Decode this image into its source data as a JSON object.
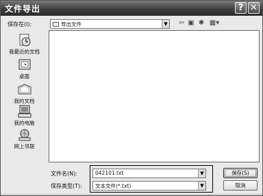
{
  "window": {
    "title": "文件导出",
    "help_label": "?",
    "close_label": "✕"
  },
  "location": {
    "label": "保存在(I):",
    "value": "导出文件"
  },
  "toolbar": {
    "back_glyph": "⇦",
    "up_glyph": "▣",
    "new_folder_glyph": "✱",
    "view_glyph": "▦▾"
  },
  "places": [
    {
      "label": "我最近的文档",
      "icon": "recent-documents-icon"
    },
    {
      "label": "桌面",
      "icon": "desktop-icon"
    },
    {
      "label": "我的文档",
      "icon": "my-documents-icon"
    },
    {
      "label": "我的电脑",
      "icon": "my-computer-icon"
    },
    {
      "label": "网上邻居",
      "icon": "network-places-icon"
    }
  ],
  "filename": {
    "label": "文件名(N):",
    "value": "042101.txt"
  },
  "filetype": {
    "label": "保存类型(T):",
    "value": "文本文件(*.txt)"
  },
  "buttons": {
    "save": "保存(S)",
    "cancel": "取消"
  }
}
